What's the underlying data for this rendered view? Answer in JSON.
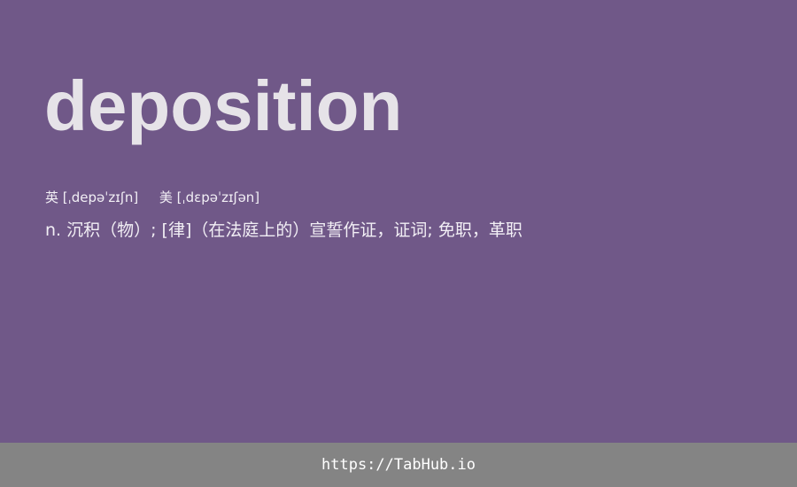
{
  "entry": {
    "word": "deposition",
    "uk_label": "英",
    "uk_phonetic": "[ˌdepəˈzɪʃn]",
    "us_label": "美",
    "us_phonetic": "[ˌdɛpəˈzɪʃən]",
    "definition": "n. 沉积（物）; [律]（在法庭上的）宣誓作证，证词; 免职，革职"
  },
  "footer": {
    "url": "https://TabHub.io"
  },
  "colors": {
    "background": "#705888",
    "word": "#e6e3e8",
    "text": "#f2eff5",
    "footer_bg": "#848484",
    "footer_text": "#ffffff"
  }
}
